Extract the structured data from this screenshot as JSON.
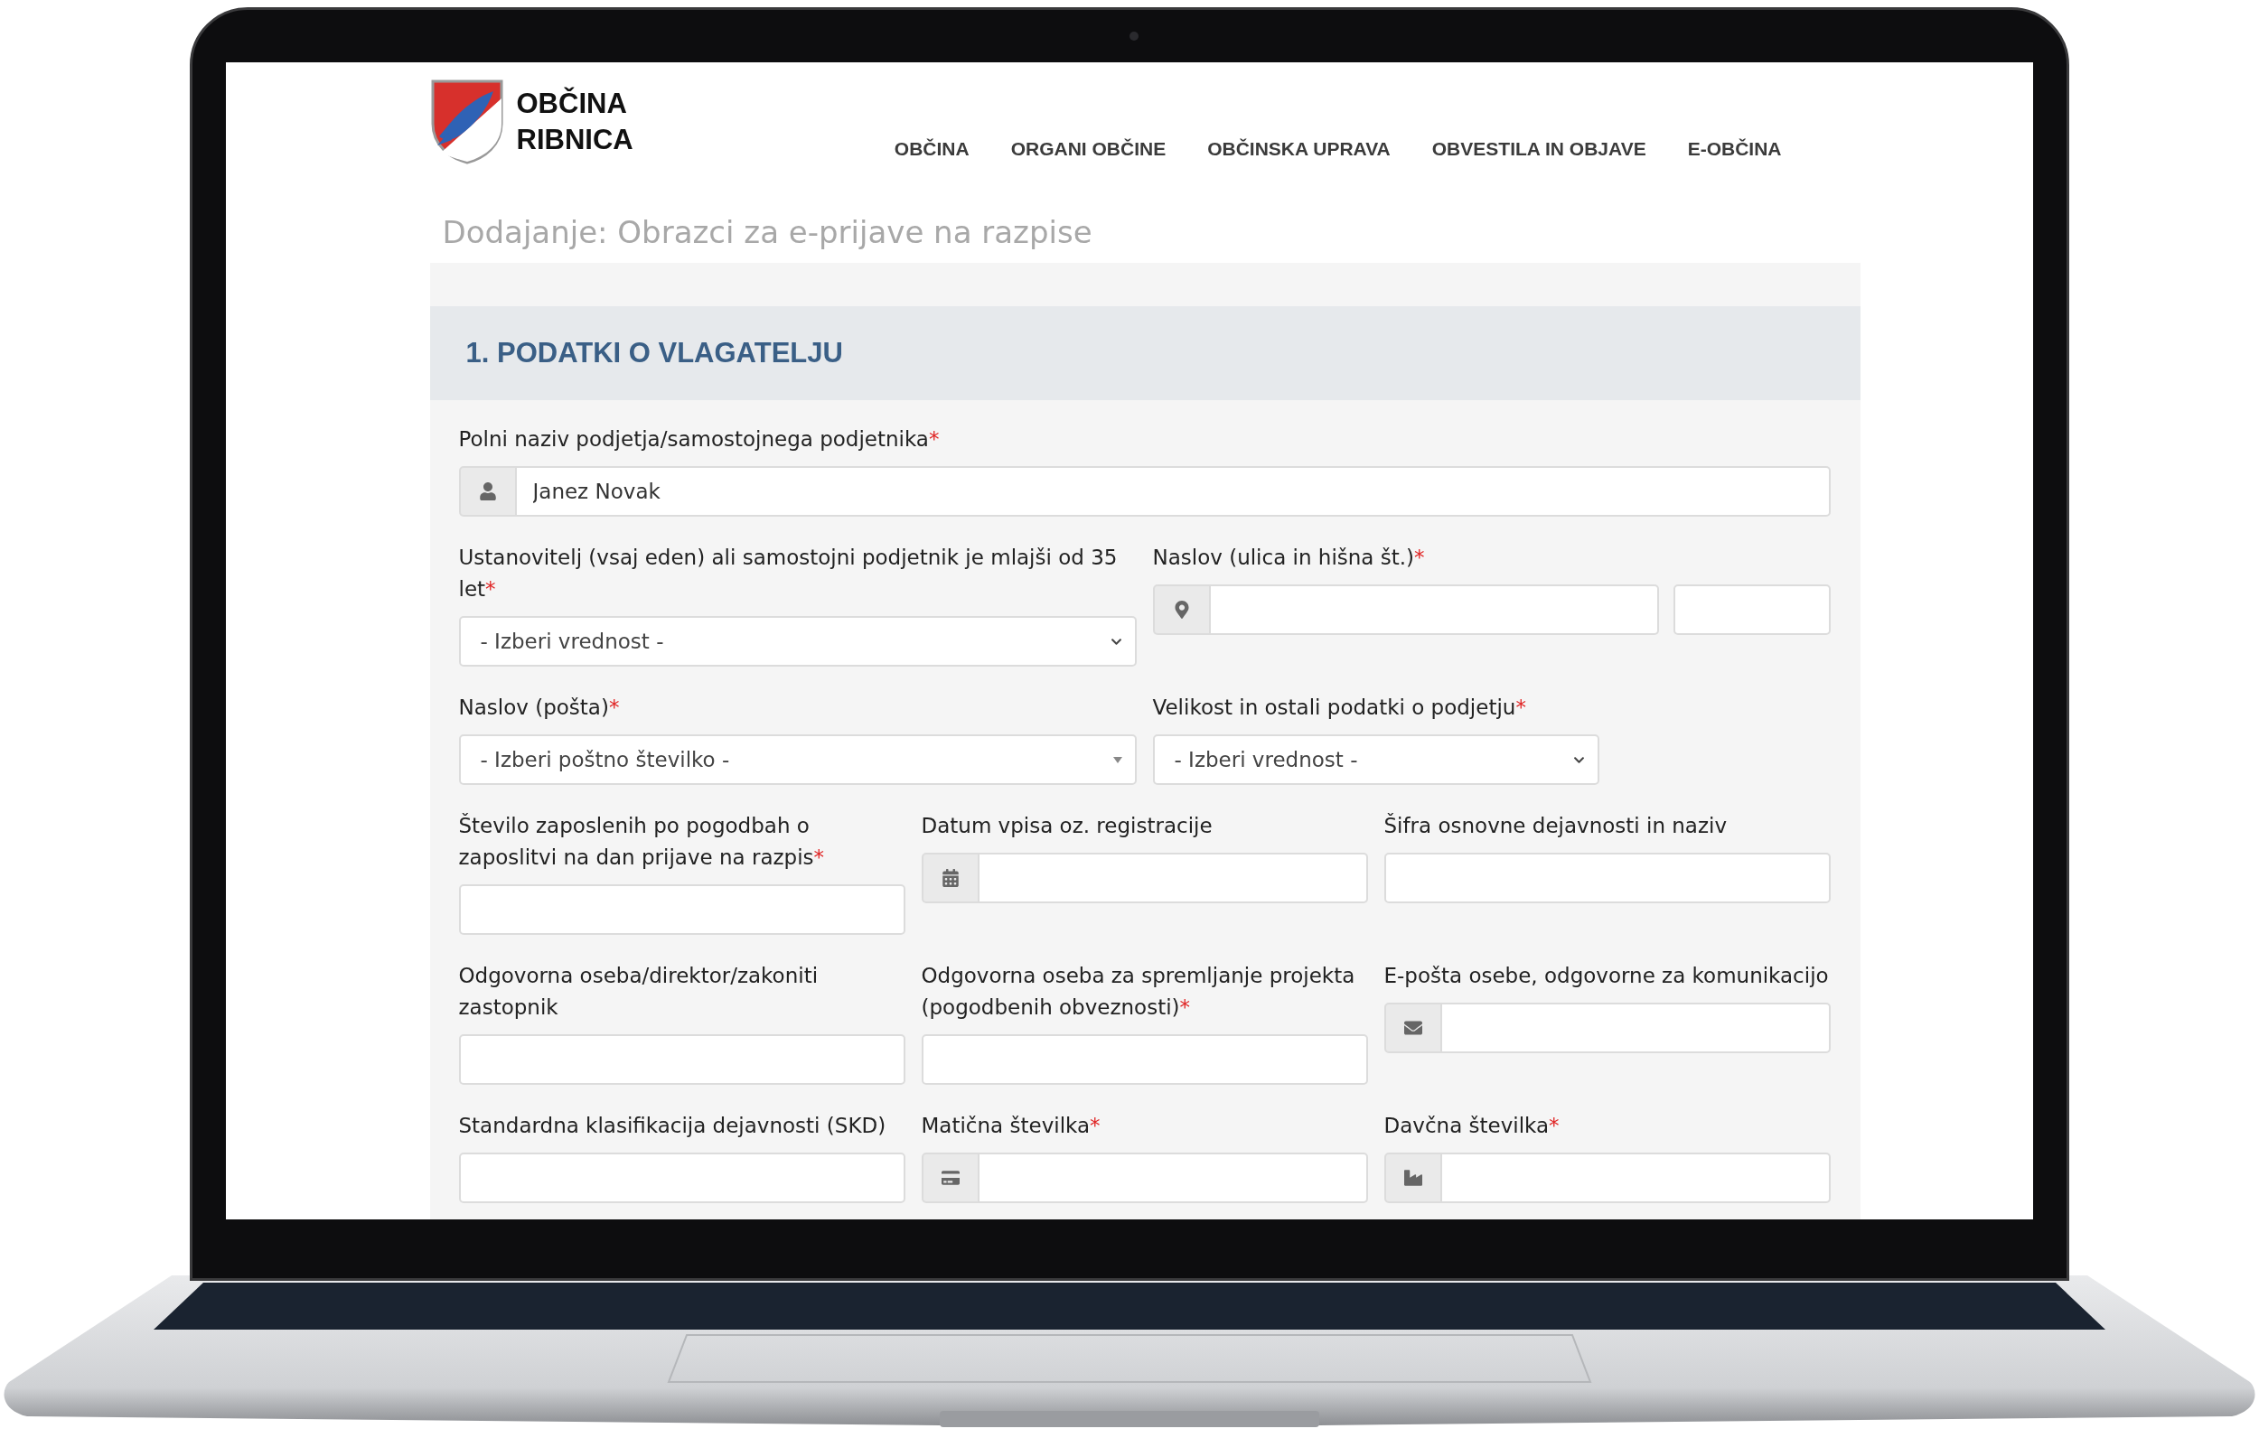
{
  "header": {
    "logo": {
      "lines": [
        "OBČINA",
        "RIBNICA"
      ]
    },
    "nav": [
      {
        "label": "OBČINA"
      },
      {
        "label": "ORGANI OBČINE"
      },
      {
        "label": "OBČINSKA UPRAVA"
      },
      {
        "label": "OBVESTILA IN OBJAVE"
      },
      {
        "label": "E-OBČINA"
      }
    ]
  },
  "page_title": "Dodajanje: Obrazci za e-prijave na razpise",
  "section": {
    "title": "1. PODATKI O VLAGATELJU",
    "rows": [
      [
        {
          "label": "Polni naziv podjetja/samostojnega podjetnika",
          "required_mark": "*",
          "kind": "name_input",
          "value": "Janez Novak"
        }
      ],
      [
        {
          "label": "Ustanovitelj (vsaj eden) ali samostojni podjetnik je mlajši od 35 let",
          "required_mark": "*",
          "kind": "select",
          "value": "- Izberi vrednost -"
        },
        {
          "label": "Naslov (ulica in hišna št.)",
          "required_mark": "*",
          "kind": "address_input"
        }
      ],
      [
        {
          "label": "Naslov (pošta)",
          "required_mark": "*",
          "kind": "search_select",
          "value": "- Izberi poštno številko -"
        },
        {
          "label": "Velikost in ostali podatki o podjetju",
          "required_mark": "*",
          "kind": "short_select",
          "value": "- Izberi vrednost -"
        }
      ],
      [
        {
          "label": "Število zaposlenih po pogodbah o zaposlitvi na dan prijave na razpis",
          "required_mark": "*",
          "kind": "text_input"
        },
        {
          "label": "Datum vpisa oz. registracije",
          "kind": "date_input"
        },
        {
          "label": "Šifra osnovne dejavnosti in naziv",
          "kind": "text_input"
        }
      ],
      [
        {
          "label": "Odgovorna oseba/direktor/zakoniti zastopnik",
          "kind": "text_input"
        },
        {
          "label": "Odgovorna oseba za spremljanje projekta (pogodbenih obveznosti)",
          "required_mark": "*",
          "kind": "text_input"
        },
        {
          "label": "E-pošta osebe, odgovorne za komunikacijo",
          "kind": "email_input"
        }
      ],
      [
        {
          "label": "Standardna klasifikacija dejavnosti (SKD)",
          "kind": "text_input"
        },
        {
          "label": "Matična številka",
          "required_mark": "*",
          "kind": "card_input"
        },
        {
          "label": "Davčna številka",
          "required_mark": "*",
          "kind": "tax_input"
        }
      ]
    ]
  }
}
